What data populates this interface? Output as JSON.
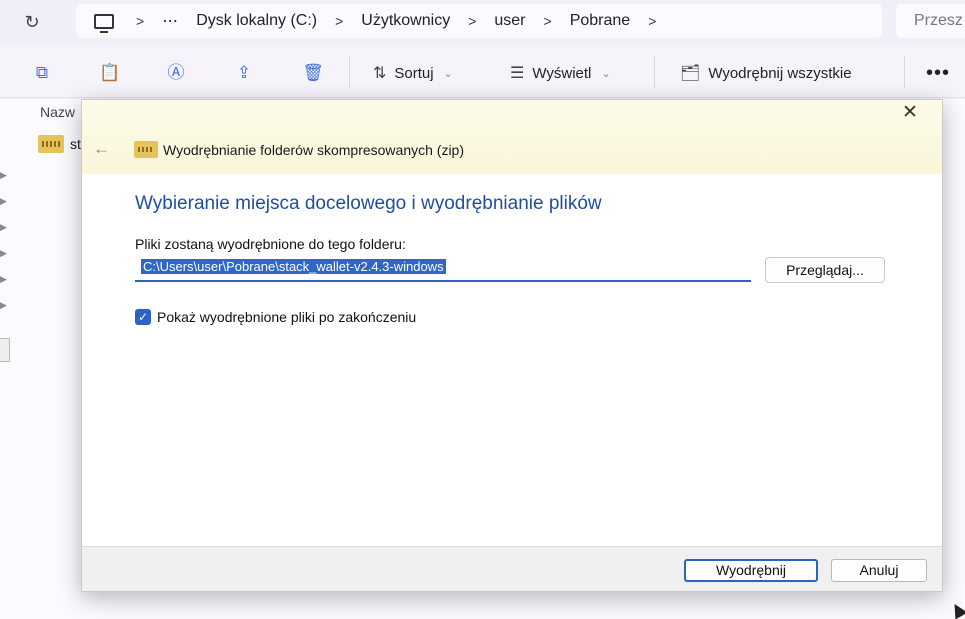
{
  "addressbar": {
    "refresh_icon": "refresh-icon",
    "crumbs": [
      "⋯",
      "Dysk lokalny (C:)",
      "Użytkownicy",
      "user",
      "Pobrane"
    ],
    "search_placeholder": "Przesz"
  },
  "toolbar": {
    "sort_label": "Sortuj",
    "view_label": "Wyświetl",
    "extract_all_label": "Wyodrębnij wszystkie",
    "more_label": "•••"
  },
  "explorer": {
    "column_header": "Nazw",
    "file_name": "st"
  },
  "dialog": {
    "title": "Wyodrębnianie folderów skompresowanych (zip)",
    "heading": "Wybieranie miejsca docelowego i wyodrębnianie plików",
    "field_label": "Pliki zostaną wyodrębnione do tego folderu:",
    "path_value": "C:\\Users\\user\\Pobrane\\stack_wallet-v2.4.3-windows",
    "browse_label": "Przeglądaj...",
    "checkbox_label": "Pokaż wyodrębnione pliki po zakończeniu",
    "checkbox_checked": true,
    "extract_button": "Wyodrębnij",
    "cancel_button": "Anuluj"
  },
  "colors": {
    "accent": "#2a63c2",
    "heading": "#1f4e9d",
    "header_band": "#f9f6d9"
  }
}
